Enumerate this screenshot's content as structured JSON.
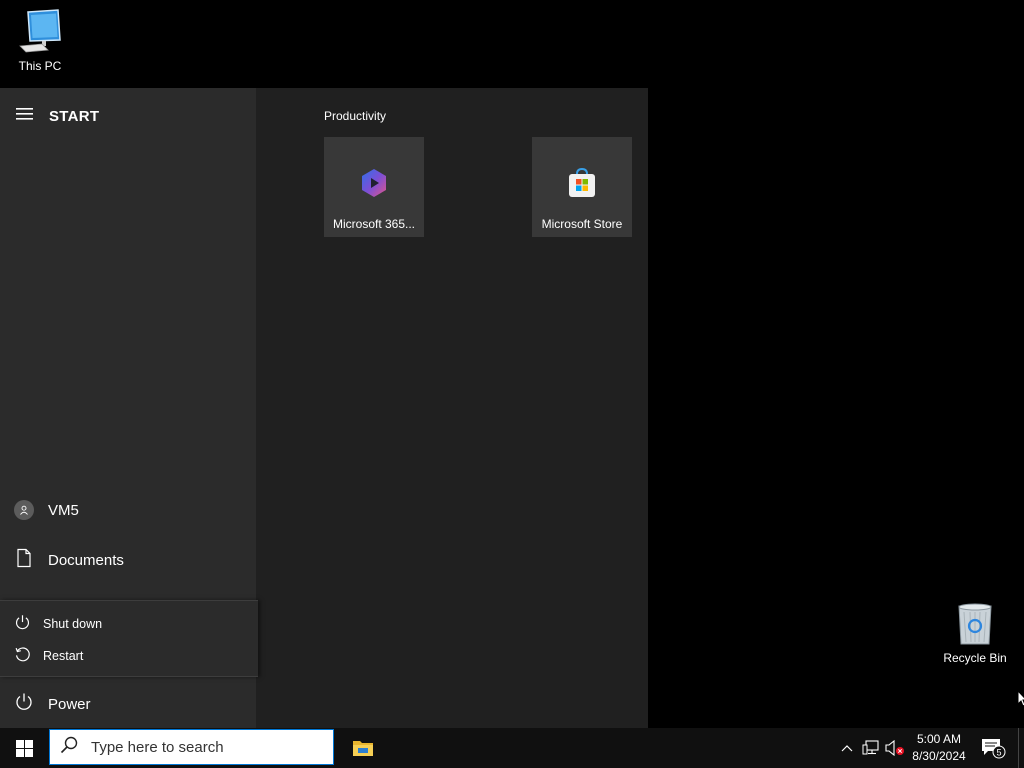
{
  "desktop": {
    "this_pc_label": "This PC",
    "recycle_bin_label": "Recycle Bin"
  },
  "start_menu": {
    "title": "START",
    "user_name": "VM5",
    "documents_label": "Documents",
    "power_label": "Power",
    "power_options": [
      "Shut down",
      "Restart"
    ],
    "group_label": "Productivity",
    "tiles": [
      {
        "label": "Microsoft 365...",
        "icon": "microsoft-365-icon"
      },
      {
        "label": "Microsoft Store",
        "icon": "microsoft-store-icon"
      }
    ]
  },
  "taskbar": {
    "search_placeholder": "Type here to search",
    "time": "5:00 AM",
    "date": "8/30/2024",
    "notification_count": "5"
  },
  "colors": {
    "accent": "#0078d7",
    "start_left_bg": "#2b2b2b",
    "start_right_bg": "#202020",
    "tile_bg": "#383838",
    "taskbar_bg": "#101010"
  }
}
